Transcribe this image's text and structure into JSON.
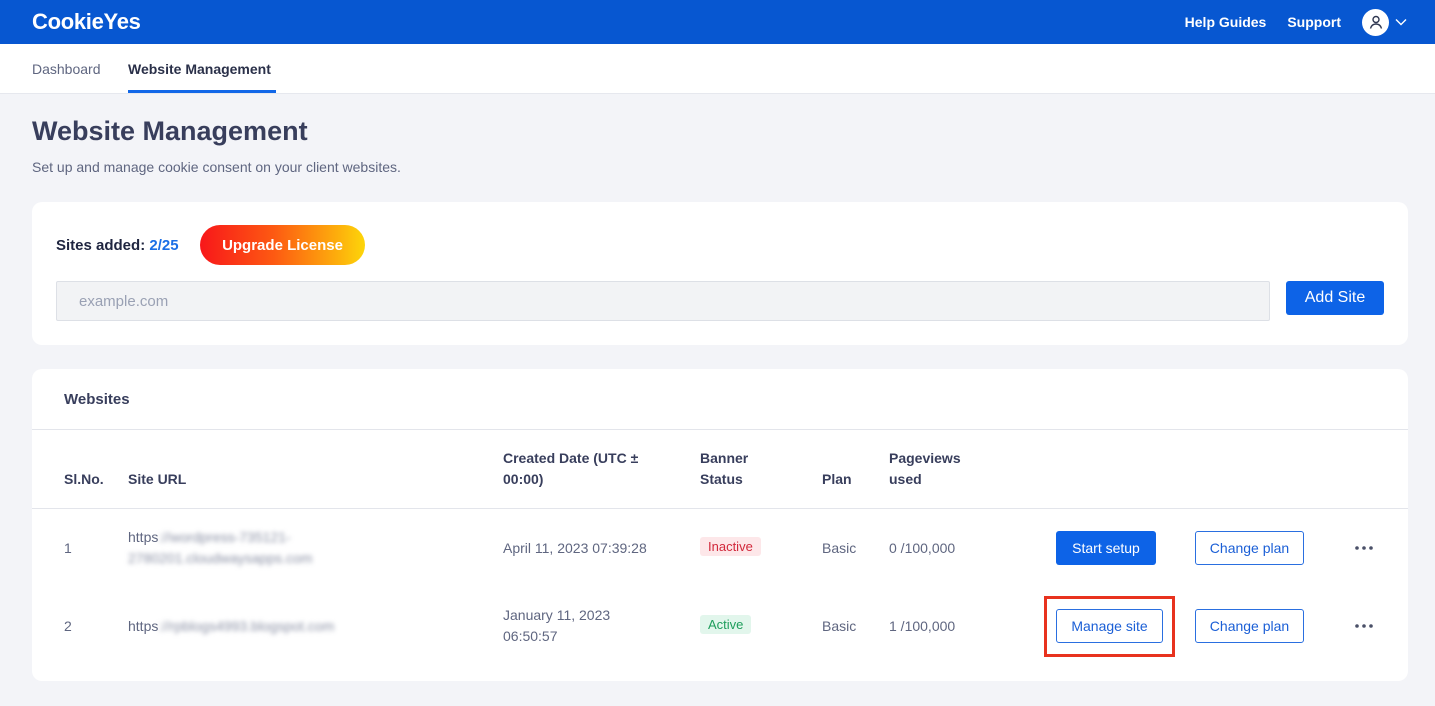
{
  "header": {
    "logo": "CookieYes",
    "nav": [
      "Help Guides",
      "Support"
    ],
    "account_icon": "user-icon",
    "menu_icon": "chevron-down-icon"
  },
  "tabs": [
    {
      "label": "Dashboard",
      "active": false
    },
    {
      "label": "Website Management",
      "active": true
    }
  ],
  "page": {
    "title": "Website Management",
    "subtitle": "Set up and manage cookie consent on your client websites."
  },
  "add_site": {
    "label": "Sites added:",
    "count": "2/25",
    "upgrade_label": "Upgrade License",
    "placeholder": "example.com",
    "button_label": "Add Site"
  },
  "websites": {
    "title": "Websites",
    "columns": {
      "slno": "Sl.No.",
      "site_url": "Site URL",
      "created_1": "Created Date (UTC ±",
      "created_2": "00:00)",
      "banner_1": "Banner",
      "banner_2": "Status",
      "plan": "Plan",
      "pageviews_1": "Pageviews",
      "pageviews_2": "used"
    },
    "rows": [
      {
        "slno": "1",
        "url_prefix": "https",
        "url_rest_1": "://wordpress-735121-",
        "url_rest_2": "2780201.cloudwaysapps.com",
        "created_1": "April 11, 2023 07:39:28",
        "created_2": "",
        "status": "Inactive",
        "plan": "Basic",
        "pageviews": "0 /100,000",
        "primary_action": "Start setup",
        "secondary_action": "Change plan"
      },
      {
        "slno": "2",
        "url_prefix": "https",
        "url_rest_1": "://rpblogs4993.blogspot.com",
        "url_rest_2": "",
        "created_1": "January 11, 2023",
        "created_2": "06:50:57",
        "status": "Active",
        "plan": "Basic",
        "pageviews": "1 /100,000",
        "primary_action": "Manage site",
        "secondary_action": "Change plan"
      }
    ]
  },
  "colors": {
    "brand": "#0757d1",
    "primary_button": "#0d63e7",
    "highlight": "#e8321e"
  }
}
